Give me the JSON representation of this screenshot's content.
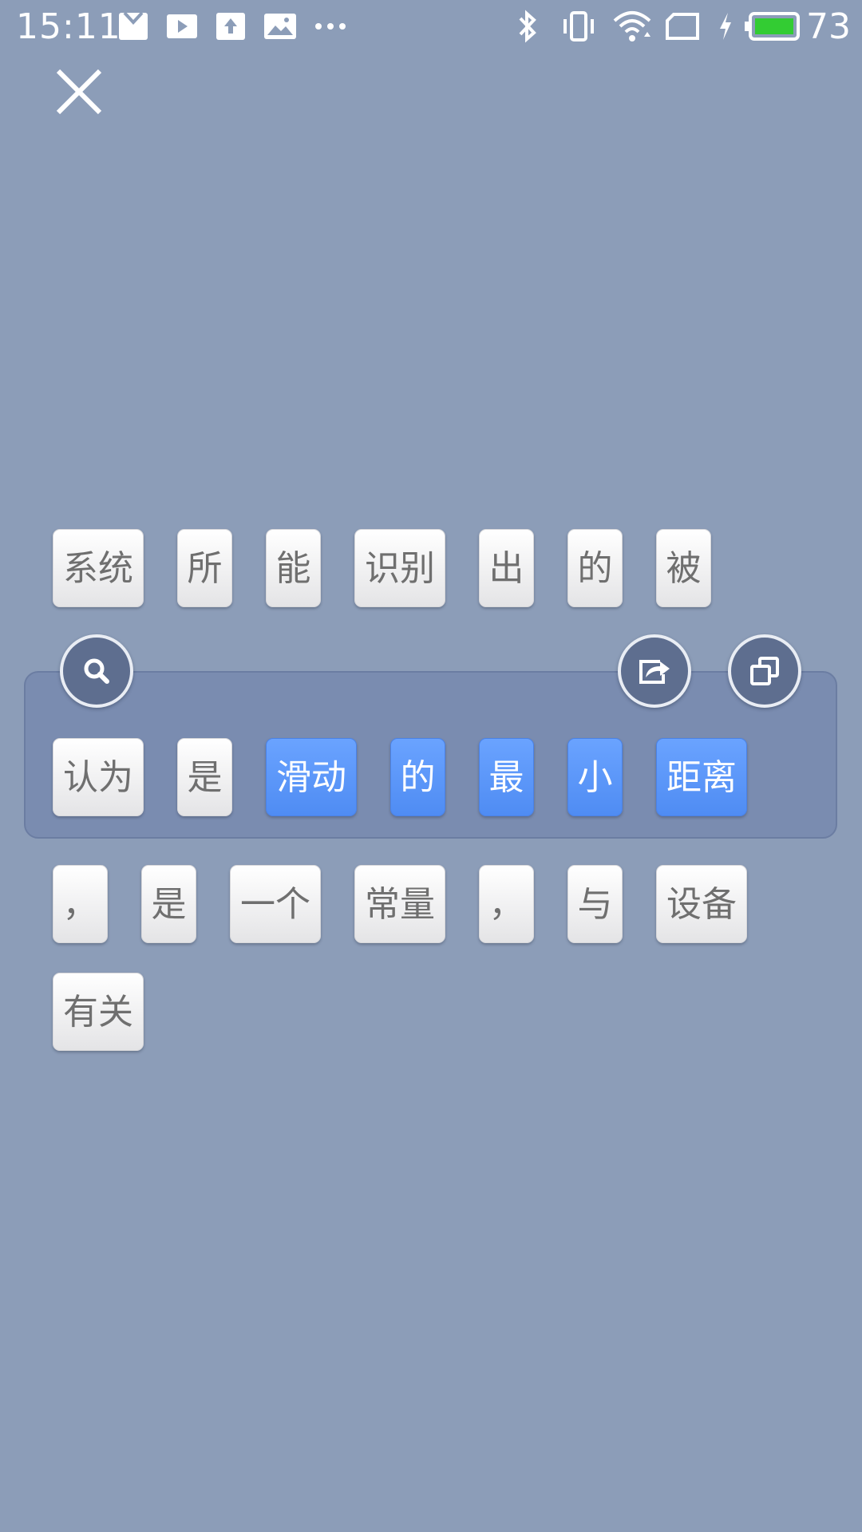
{
  "status_bar": {
    "time": "15:11",
    "battery_percent": "73",
    "icons": [
      "mail-icon",
      "play-icon",
      "upload-icon",
      "image-icon",
      "more-dots-icon",
      "bluetooth-icon",
      "vibrate-icon",
      "wifi-icon",
      "sim-icon",
      "charging-icon",
      "battery-icon"
    ],
    "battery_color": "#33cc33"
  },
  "close_icon": "close-icon",
  "actions": {
    "search_icon": "search-icon",
    "share_icon": "share-icon",
    "copy_icon": "copy-icon"
  },
  "words": [
    {
      "text": "系统",
      "selected": false
    },
    {
      "text": "所",
      "selected": false
    },
    {
      "text": "能",
      "selected": false
    },
    {
      "text": "识别",
      "selected": false
    },
    {
      "text": "出",
      "selected": false
    },
    {
      "text": "的",
      "selected": false
    },
    {
      "text": "被",
      "selected": false
    },
    {
      "text": "认为",
      "selected": false
    },
    {
      "text": "是",
      "selected": false
    },
    {
      "text": "滑动",
      "selected": true
    },
    {
      "text": "的",
      "selected": true
    },
    {
      "text": "最",
      "selected": true
    },
    {
      "text": "小",
      "selected": true
    },
    {
      "text": "距离",
      "selected": true
    },
    {
      "text": "，",
      "selected": false
    },
    {
      "text": "是",
      "selected": false
    },
    {
      "text": "一个",
      "selected": false
    },
    {
      "text": "常量",
      "selected": false
    },
    {
      "text": "，",
      "selected": false
    },
    {
      "text": "与",
      "selected": false
    },
    {
      "text": "设备",
      "selected": false
    },
    {
      "text": "有关",
      "selected": false
    }
  ],
  "colors": {
    "background": "#8c9db8",
    "selected_chip": "#5b95f8",
    "selection_panel": "#7a8cb0"
  }
}
